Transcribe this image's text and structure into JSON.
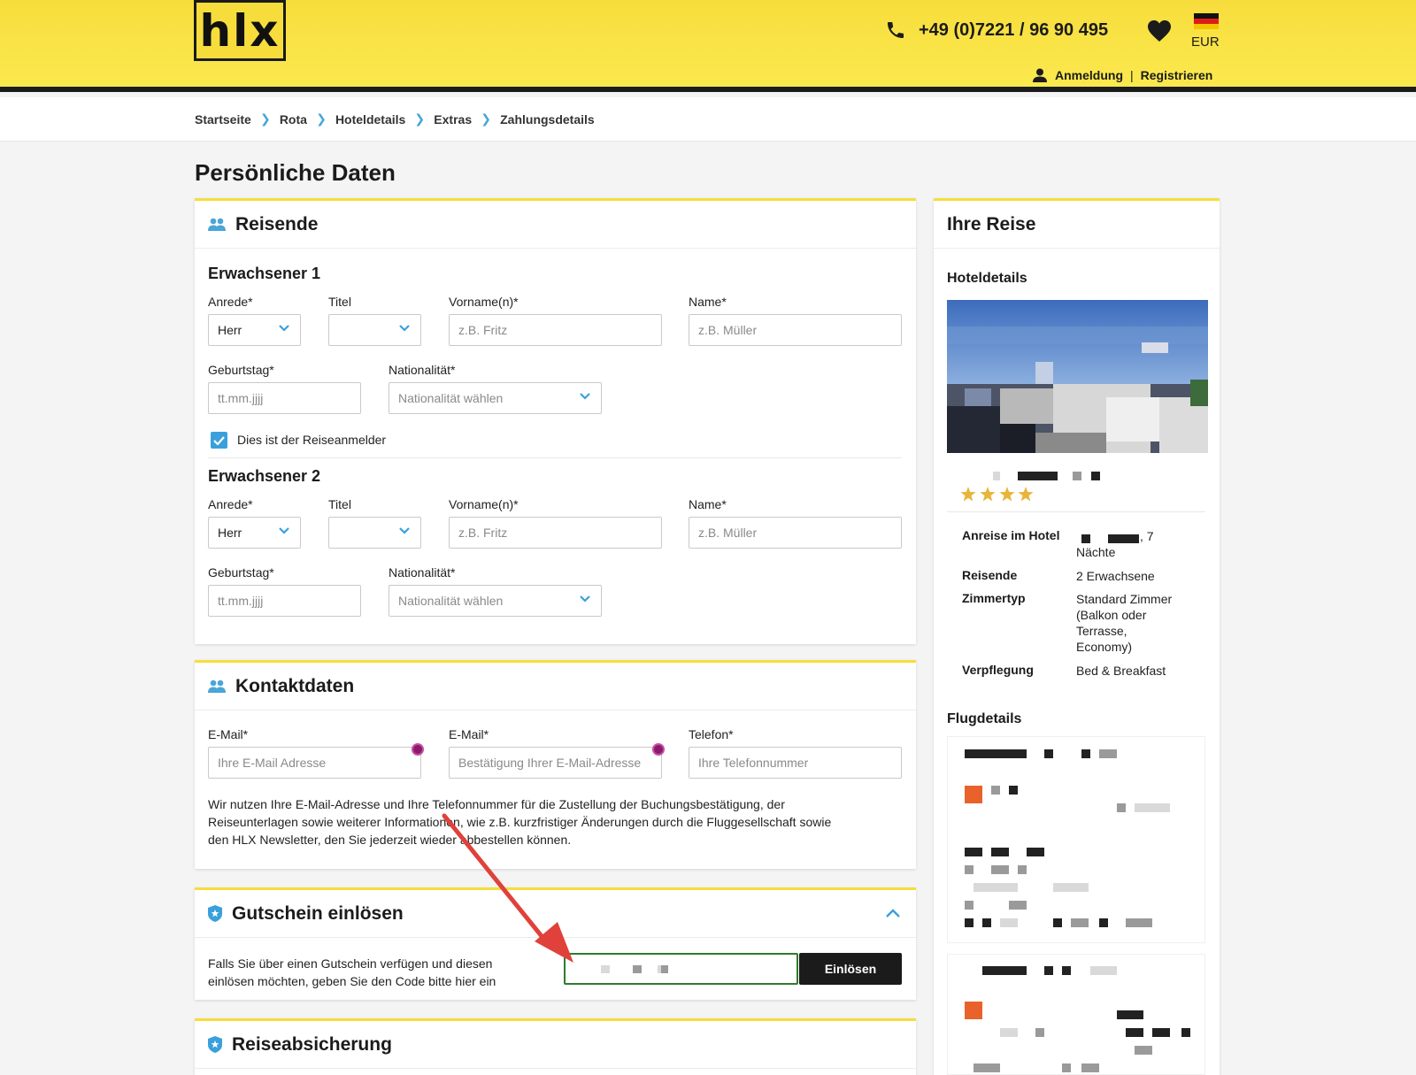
{
  "header": {
    "logo_text": "hlx",
    "phone": "+49 (0)7221 / 96 90 495",
    "currency": "EUR",
    "login": "Anmeldung",
    "separator": "|",
    "register": "Registrieren"
  },
  "breadcrumb": [
    "Startseite",
    "Rota",
    "Hoteldetails",
    "Extras",
    "Zahlungsdetails"
  ],
  "page_title": "Persönliche Daten",
  "travelers": {
    "title": "Reisende",
    "adult1": {
      "heading": "Erwachsener 1",
      "salutation_label": "Anrede*",
      "salutation_value": "Herr",
      "title_label": "Titel",
      "firstname_label": "Vorname(n)*",
      "firstname_placeholder": "z.B. Fritz",
      "lastname_label": "Name*",
      "lastname_placeholder": "z.B. Müller",
      "birthday_label": "Geburtstag*",
      "birthday_placeholder": "tt.mm.jjjj",
      "nationality_label": "Nationalität*",
      "nationality_value": "Nationalität wählen",
      "registrant_checkbox": "Dies ist der Reiseanmelder"
    },
    "adult2": {
      "heading": "Erwachsener 2",
      "salutation_label": "Anrede*",
      "salutation_value": "Herr",
      "title_label": "Titel",
      "firstname_label": "Vorname(n)*",
      "firstname_placeholder": "z.B. Fritz",
      "lastname_label": "Name*",
      "lastname_placeholder": "z.B. Müller",
      "birthday_label": "Geburtstag*",
      "birthday_placeholder": "tt.mm.jjjj",
      "nationality_label": "Nationalität*",
      "nationality_value": "Nationalität wählen"
    }
  },
  "contact": {
    "title": "Kontaktdaten",
    "email_label": "E-Mail*",
    "email_placeholder": "Ihre E-Mail Adresse",
    "email_confirm_label": "E-Mail*",
    "email_confirm_placeholder": "Bestätigung Ihrer E-Mail-Adresse",
    "phone_label": "Telefon*",
    "phone_placeholder": "Ihre Telefonnummer",
    "info_line1": "Wir nutzen Ihre E-Mail-Adresse und Ihre Telefonnummer für die Zustellung der Buchungsbestätigung, der",
    "info_line2": "Reiseunterlagen sowie weiterer Informationen, wie z.B. kurzfristiger Änderungen durch die Fluggesellschaft sowie",
    "info_line3": "den HLX Newsletter, den Sie jederzeit wieder abbestellen können."
  },
  "voucher": {
    "title": "Gutschein einlösen",
    "text_line1": "Falls Sie über einen Gutschein verfügen und diesen",
    "text_line2": "einlösen möchten, geben Sie den Code bitte hier ein",
    "button": "Einlösen"
  },
  "insurance": {
    "title": "Reiseabsicherung"
  },
  "trip": {
    "title": "Ihre Reise",
    "hotel_details": "Hoteldetails",
    "stars": 4,
    "arrival_label": "Anreise im Hotel",
    "arrival_value_suffix": ", 7",
    "arrival_nights": "Nächte",
    "travelers_label": "Reisende",
    "travelers_value": "2 Erwachsene",
    "room_label": "Zimmertyp",
    "room_line1": "Standard Zimmer",
    "room_line2": "(Balkon oder",
    "room_line3": "Terrasse,",
    "room_line4": "Economy)",
    "board_label": "Verpflegung",
    "board_value": "Bed & Breakfast",
    "flight_details": "Flugdetails"
  },
  "colors": {
    "brand_yellow": "#f7dd3c",
    "accent_blue": "#3aa0dc",
    "annotation_red": "#e0413b"
  }
}
